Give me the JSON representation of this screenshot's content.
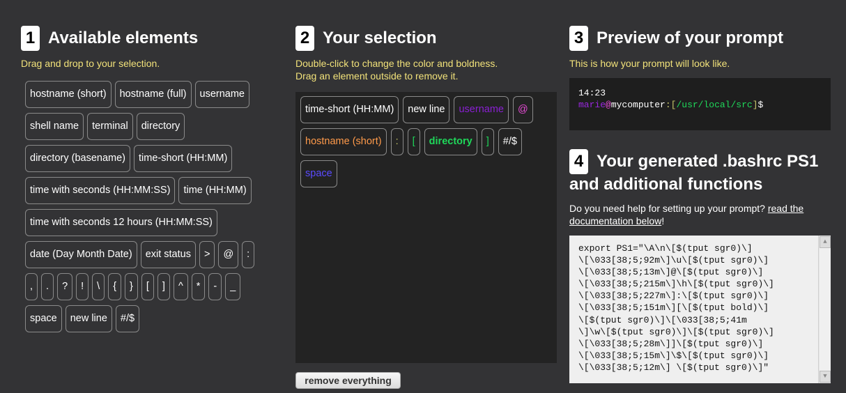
{
  "section1": {
    "number": "1",
    "title": "Available elements",
    "hint": "Drag and drop to your selection.",
    "elements": [
      "hostname (short)",
      "hostname (full)",
      "username",
      "shell name",
      "terminal",
      "directory",
      "directory (basename)",
      "time-short (HH:MM)",
      "time with seconds (HH:MM:SS)",
      "time (HH:MM)",
      "time with seconds 12 hours (HH:MM:SS)",
      "date (Day Month Date)",
      "exit status",
      ">",
      "@",
      ":",
      ",",
      ".",
      "?",
      "!",
      "\\",
      "{",
      "}",
      "[",
      "]",
      "^",
      "*",
      "-",
      "_",
      "space",
      "new line",
      "#/$"
    ]
  },
  "section2": {
    "number": "2",
    "title": "Your selection",
    "hint_line1": "Double-click to change the color and boldness.",
    "hint_line2": "Drag an element outside to remove it.",
    "selection": [
      {
        "label": "time-short (HH:MM)",
        "color": "#ffffff",
        "bold": false
      },
      {
        "label": "new line",
        "color": "#ffffff",
        "bold": false
      },
      {
        "label": "username",
        "color": "#8a1fd4",
        "bold": false
      },
      {
        "label": "@",
        "color": "#e84bd7",
        "bold": false
      },
      {
        "label": "hostname (short)",
        "color": "#ff9a4a",
        "bold": false
      },
      {
        "label": ":",
        "color": "#c7c76a",
        "bold": false
      },
      {
        "label": "[",
        "color": "#1fd85a",
        "bold": false
      },
      {
        "label": "directory",
        "color": "#1fd85a",
        "bold": true
      },
      {
        "label": "]",
        "color": "#1fd85a",
        "bold": false
      },
      {
        "label": "#/$",
        "color": "#ffffff",
        "bold": false
      },
      {
        "label": "space",
        "color": "#5b4bff",
        "bold": false
      }
    ],
    "remove_label": "remove everything"
  },
  "section3": {
    "number": "3",
    "title": "Preview of your prompt",
    "hint": "This is how your prompt will look like.",
    "preview": {
      "time": "14:23",
      "user": "marie",
      "at": "@",
      "host": "mycomputer",
      "colon": ":",
      "bracket_open": "[",
      "dir": "/usr/local/src",
      "bracket_close": "]",
      "dollar": "$"
    }
  },
  "section4": {
    "number": "4",
    "title_line1": "Your generated .bashrc PS1",
    "title_line2": "and additional functions",
    "help_prefix": "Do you need help for setting up your prompt?",
    "help_link": "read the documentation below",
    "help_suffix": "!",
    "code_lines": [
      "export PS1=\"\\A\\n\\[$(tput sgr0)\\]",
      "\\[\\033[38;5;92m\\]\\u\\[$(tput sgr0)\\]",
      "\\[\\033[38;5;13m\\]@\\[$(tput sgr0)\\]",
      "\\[\\033[38;5;215m\\]\\h\\[$(tput sgr0)\\]",
      "\\[\\033[38;5;227m\\]:\\[$(tput sgr0)\\]",
      "\\[\\033[38;5;151m\\][\\[$(tput bold)\\]",
      "\\[$(tput sgr0)\\]\\[\\033[38;5;41m",
      "\\]\\w\\[$(tput sgr0)\\]\\[$(tput sgr0)\\]",
      "\\[\\033[38;5;28m\\]]\\[$(tput sgr0)\\]",
      "\\[\\033[38;5;15m\\]\\$\\[$(tput sgr0)\\]",
      "\\[\\033[38;5;12m\\] \\[$(tput sgr0)\\]\""
    ]
  }
}
